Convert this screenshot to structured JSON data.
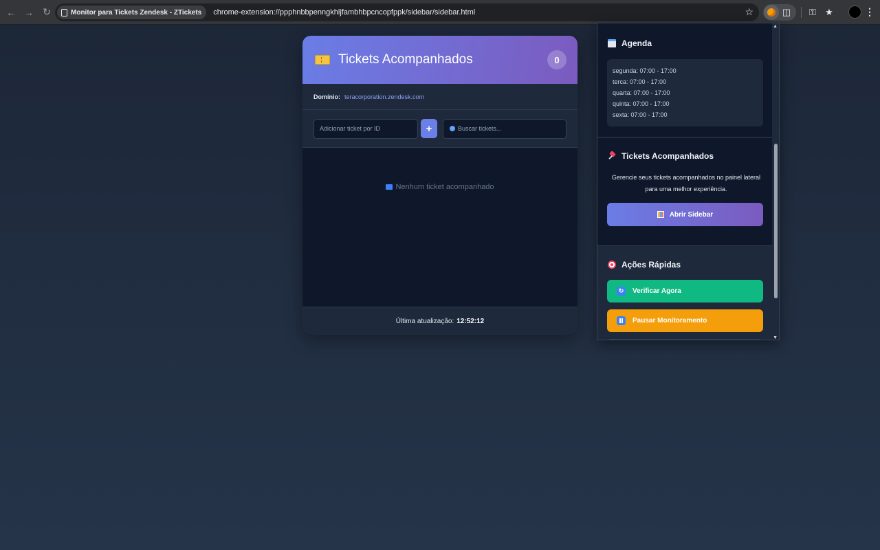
{
  "browser": {
    "tab_title": "Monitor para Tickets Zendesk - ZTickets",
    "url": "chrome-extension://ppphnbbpenngkhljfambhbpcncopfppk/sidebar/sidebar.html",
    "icons": [
      "back-icon",
      "forward-icon",
      "reload-icon",
      "bookmark-star-icon",
      "extension-icon",
      "puzzle-icon",
      "key-icon",
      "favorites-icon",
      "profile-avatar",
      "menu-icon"
    ]
  },
  "card": {
    "title": "Tickets Acompanhados",
    "count": "0",
    "domain_label": "Domínio:",
    "domain_value": "teracorporation.zendesk.com",
    "add_placeholder": "Adicionar ticket por ID",
    "add_button": "+",
    "search_placeholder": "Buscar tickets...",
    "empty_message": "Nenhum ticket acompanhado",
    "footer_label": "Última atualização:",
    "footer_time": "12:52:12"
  },
  "popup": {
    "agenda": {
      "title": "Agenda",
      "schedule": [
        "segunda: 07:00 - 17:00",
        "terca: 07:00 - 17:00",
        "quarta: 07:00 - 17:00",
        "quinta: 07:00 - 17:00",
        "sexta: 07:00 - 17:00"
      ]
    },
    "tickets": {
      "title": "Tickets Acompanhados",
      "description_line1": "Gerencie seus tickets acompanhados no painel lateral",
      "description_line2": "para uma melhor experiência.",
      "button": "Abrir Sidebar"
    },
    "actions": {
      "title": "Ações Rápidas",
      "verify_button": "Verificar Agora",
      "pause_button": "Pausar Monitoramento"
    }
  },
  "colors": {
    "header_gradient_start": "#6a7de6",
    "header_gradient_end": "#7b5bbf",
    "verify_green": "#10b981",
    "pause_orange": "#f59e0b",
    "domain_link": "#8ea2f5"
  }
}
